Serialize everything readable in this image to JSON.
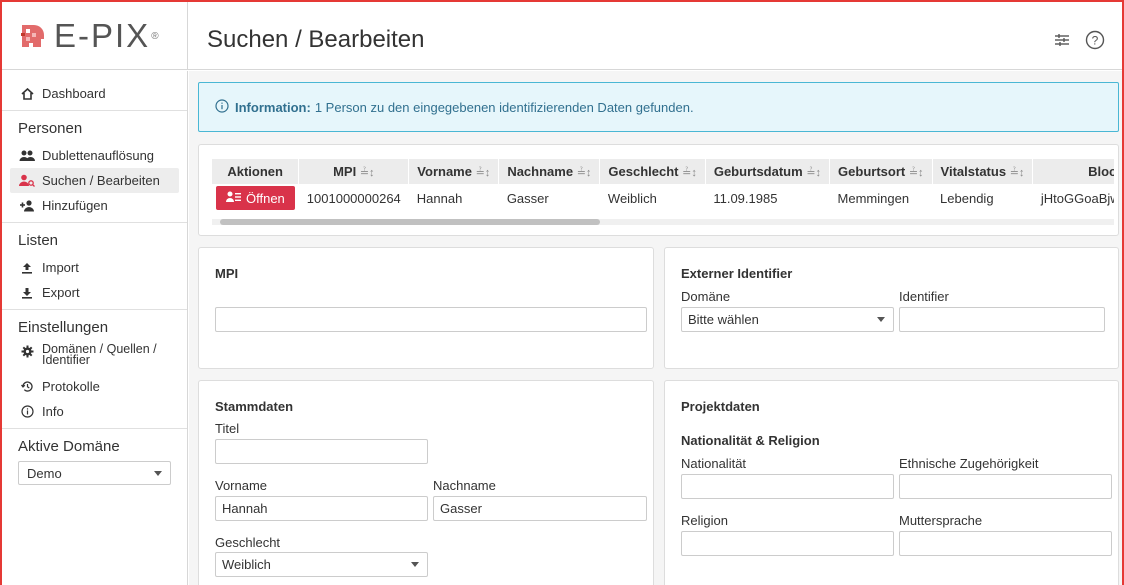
{
  "app": {
    "logo": "E-PIX",
    "logo_reg": "®",
    "page_title": "Suchen / Bearbeiten"
  },
  "header": {
    "icons": [
      "sliders-icon",
      "help-icon"
    ]
  },
  "sidebar": {
    "dashboard": "Dashboard",
    "section_personen": "Personen",
    "dubletten": "Dublettenauflösung",
    "suchen": "Suchen / Bearbeiten",
    "hinzufuegen": "Hinzufügen",
    "section_listen": "Listen",
    "import": "Import",
    "export": "Export",
    "section_einstellungen": "Einstellungen",
    "domaenen_l1": "Domänen / Quellen /",
    "domaenen_l2": "Identifier",
    "protokolle": "Protokolle",
    "info": "Info",
    "section_aktive": "Aktive Domäne",
    "domain_value": "Demo"
  },
  "info": {
    "label": "Information:",
    "text": "1 Person zu den eingegebenen identifizierenden Daten gefunden."
  },
  "results": {
    "columns": [
      "Aktionen",
      "MPI",
      "Vorname",
      "Nachname",
      "Geschlecht",
      "Geburtsdatum",
      "Geburtsort",
      "Vitalstatus",
      "Bloom"
    ],
    "row": {
      "open": "Öffnen",
      "mpi": "1001000000264",
      "vorname": "Hannah",
      "nachname": "Gasser",
      "geschlecht": "Weiblich",
      "geburtsdatum": "11.09.1985",
      "geburtsort": "Memmingen",
      "vitalstatus": "Lebendig",
      "bloom": "jHtoGGoaBjwN"
    }
  },
  "mpi_card": {
    "title": "MPI",
    "value": ""
  },
  "ext_card": {
    "title": "Externer Identifier",
    "domain_label": "Domäne",
    "domain_value": "Bitte wählen",
    "identifier_label": "Identifier",
    "identifier_value": ""
  },
  "stamm": {
    "title": "Stammdaten",
    "titel_label": "Titel",
    "titel_value": "",
    "vorname_label": "Vorname",
    "vorname_value": "Hannah",
    "nachname_label": "Nachname",
    "nachname_value": "Gasser",
    "geschlecht_label": "Geschlecht",
    "geschlecht_value": "Weiblich"
  },
  "projekt": {
    "title": "Projektdaten",
    "subtitle": "Nationalität & Religion",
    "nationalitaet_label": "Nationalität",
    "ethnisch_label": "Ethnische Zugehörigkeit",
    "religion_label": "Religion",
    "muttersprache_label": "Muttersprache"
  },
  "colors": {
    "accent": "#d9334a",
    "info_border": "#4ab7d4",
    "info_bg": "#e6f6fb",
    "frame": "#e53935"
  }
}
